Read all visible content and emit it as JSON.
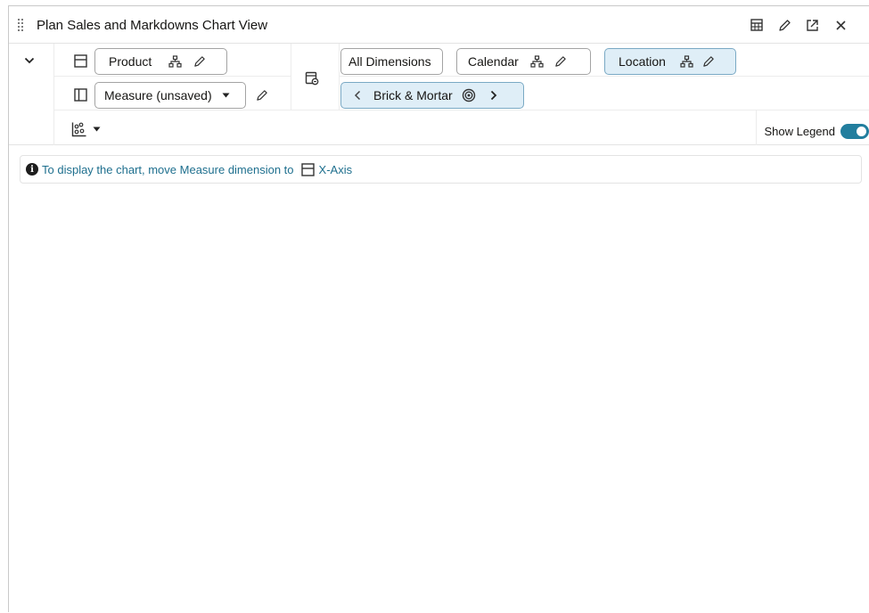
{
  "window": {
    "title": "Plan Sales and Markdowns Chart View"
  },
  "layout_area": {
    "row1": {
      "product_chip": "Product"
    },
    "row2": {
      "measure_select": "Measure (unsaved)"
    }
  },
  "filters": {
    "row1": [
      {
        "label": "All Dimensions",
        "active": false,
        "hierarchy": false,
        "editable": false
      },
      {
        "label": "Calendar",
        "active": false,
        "hierarchy": true,
        "editable": true
      },
      {
        "label": "Location",
        "active": true,
        "hierarchy": true,
        "editable": true
      }
    ],
    "navigator": {
      "label": "Brick & Mortar"
    }
  },
  "chart_options": {
    "show_legend_label": "Show Legend",
    "show_legend_on": true
  },
  "message": {
    "text": "To display the chart, move Measure dimension to",
    "target": "X-Axis"
  },
  "colors": {
    "accent": "#227e9e",
    "link_text": "#1e6f8e",
    "active_chip_bg": "#dfeef7"
  },
  "icons": [
    "drag-handle-icon",
    "table-icon",
    "pencil-icon",
    "expand-icon",
    "close-icon",
    "chevron-down-icon",
    "row-axis-icon",
    "column-axis-icon",
    "hierarchy-icon",
    "pivot-icon",
    "chart-type-icon",
    "target-icon",
    "info-icon"
  ]
}
